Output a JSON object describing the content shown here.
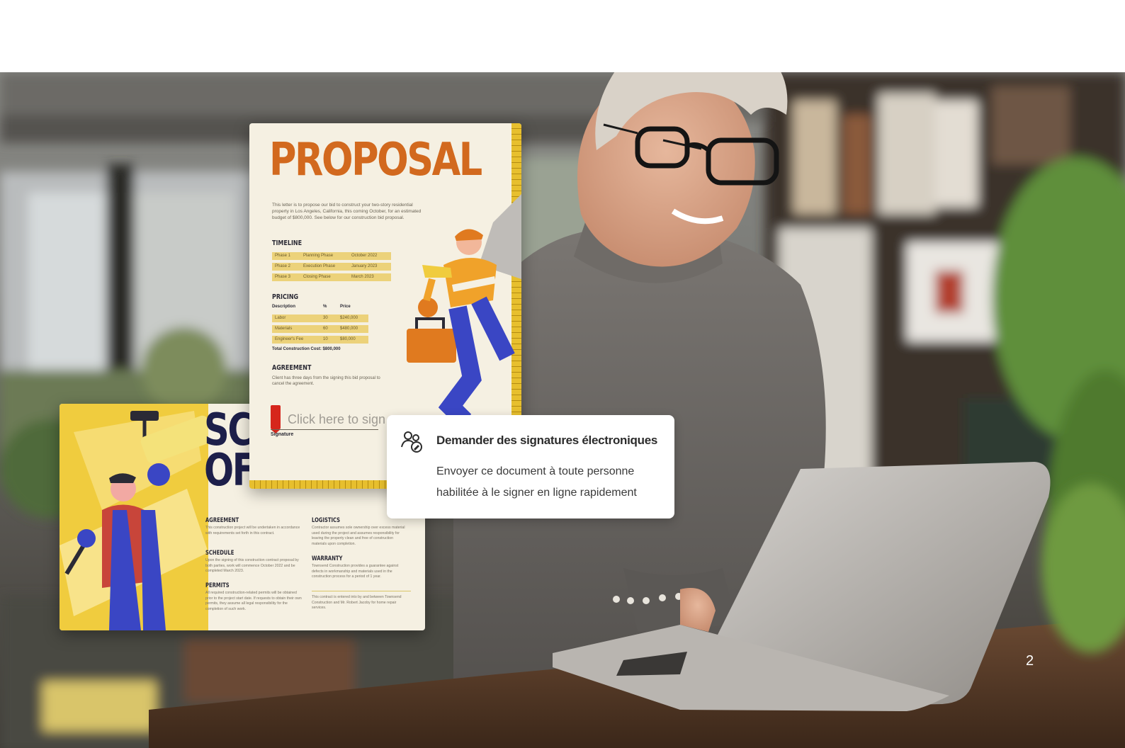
{
  "proposal_doc": {
    "title": "PROPOSAL",
    "intro": "This letter is to propose our bid to construct your two-story residential property in Los Angeles, California, this coming October, for an estimated budget of $800,000. See below for our construction bid proposal.",
    "timeline_heading": "TIMELINE",
    "timeline": [
      [
        "Phase 1",
        "Planning Phase",
        "October 2022"
      ],
      [
        "Phase 2",
        "Execution Phase",
        "January 2023"
      ],
      [
        "Phase 3",
        "Closing Phase",
        "March 2023"
      ]
    ],
    "pricing_heading": "PRICING",
    "pricing_header": [
      "Description",
      "%",
      "Price"
    ],
    "pricing": [
      [
        "Labor",
        "30",
        "$240,000"
      ],
      [
        "Materials",
        "60",
        "$480,000"
      ],
      [
        "Engineer's Fee",
        "10",
        "$80,000"
      ]
    ],
    "total": "Total Construction Cost: $800,000",
    "agreement_heading": "AGREEMENT",
    "agreement_text": "Client has three days from the signing this bid proposal to cancel the agreement.",
    "sign_placeholder": "Click here to sign",
    "signature_label": "Signature"
  },
  "scope_doc": {
    "title_line1": "SC",
    "title_line2": "OF WORK",
    "sections": [
      {
        "heading": "AGREEMENT",
        "text": "This construction project will be undertaken in accordance with requirements set forth in this contract."
      },
      {
        "heading": "SCHEDULE",
        "text": "Upon the signing of this construction contract proposal by both parties, work will commence October 2022 and be completed March 2023."
      },
      {
        "heading": "PERMITS",
        "text": "All required construction-related permits will be obtained prior to the project start date. If requests to obtain their own permits, they assume all legal responsibility for the completion of such work."
      },
      {
        "heading": "LOGISTICS",
        "text": "Contractor assumes sole ownership over excess material used during the project and assumes responsibility for leaving the property clean and free of construction materials upon completion."
      },
      {
        "heading": "WARRANTY",
        "text": "Townsend Construction provides a guarantee against defects in workmanship and materials used in the construction process for a period of 1 year."
      }
    ],
    "footer_text": "This contract is entered into by and between Townsend Construction and Mr. Robert Jacoby for home repair services."
  },
  "tooltip": {
    "icon": "request-signatures-icon",
    "title": "Demander des signatures électroniques",
    "body": "Envoyer ce document à toute personne habilitée à le signer en ligne rapidement"
  },
  "page_number": "2",
  "colors": {
    "proposal_accent": "#d2691e",
    "highlight": "#ecd27a",
    "scope_title": "#1d1f4a",
    "scope_yellow": "#f0cc3e",
    "sign_red": "#d6261c"
  }
}
